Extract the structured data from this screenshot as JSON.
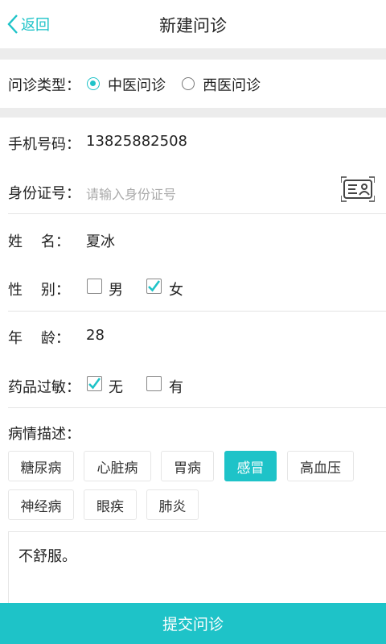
{
  "header": {
    "back_label": "返回",
    "title": "新建问诊"
  },
  "consult_type": {
    "label": "问诊类型：",
    "options": [
      {
        "label": "中医问诊",
        "selected": true
      },
      {
        "label": "西医问诊",
        "selected": false
      }
    ]
  },
  "form": {
    "phone": {
      "label": "手机号码：",
      "value": "13825882508"
    },
    "id_card": {
      "label": "身份证号：",
      "placeholder": "请输入身份证号",
      "scan_icon": "id-card-scan-icon"
    },
    "name": {
      "label": "姓    名：",
      "value": "夏冰"
    },
    "gender": {
      "label": "性    别：",
      "options": [
        {
          "label": "男",
          "checked": false
        },
        {
          "label": "女",
          "checked": true
        }
      ]
    },
    "age": {
      "label": "年    龄：",
      "value": "28"
    },
    "allergy": {
      "label": "药品过敏：",
      "options": [
        {
          "label": "无",
          "checked": true
        },
        {
          "label": "有",
          "checked": false
        }
      ]
    }
  },
  "condition": {
    "label": "病情描述：",
    "tags": [
      {
        "label": "糖尿病",
        "selected": false
      },
      {
        "label": "心脏病",
        "selected": false
      },
      {
        "label": "胃病",
        "selected": false
      },
      {
        "label": "感冒",
        "selected": true
      },
      {
        "label": "高血压",
        "selected": false
      },
      {
        "label": "神经病",
        "selected": false
      },
      {
        "label": "眼疾",
        "selected": false
      },
      {
        "label": "肺炎",
        "selected": false
      }
    ],
    "description": "不舒服。"
  },
  "submit_label": "提交问诊",
  "colors": {
    "accent": "#1ec3c8",
    "band": "#ececec"
  }
}
